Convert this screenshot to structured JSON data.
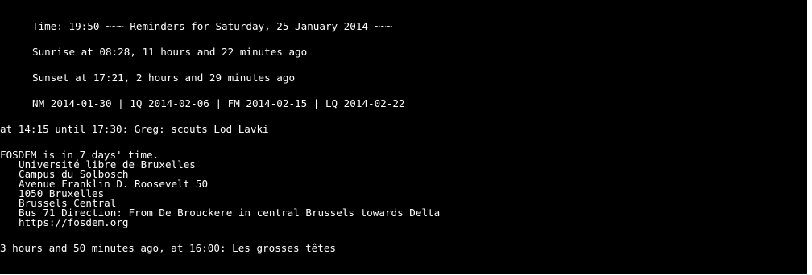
{
  "header": {
    "time_line": "Time: 19:50 ~~~ Reminders for Saturday, 25 January 2014 ~~~",
    "sunrise_line": "Sunrise at 08:28, 11 hours and 22 minutes ago",
    "sunset_line": "Sunset at 17:21, 2 hours and 29 minutes ago",
    "moon_line": "NM 2014-01-30 | 1Q 2014-02-06 | FM 2014-02-15 | LQ 2014-02-22"
  },
  "reminders": {
    "scouts_line": "at 14:15 until 17:30: Greg: scouts Lod Lavki",
    "fosdem_title": "FOSDEM is in 7 days' time.",
    "fosdem_details": [
      "Université libre de Bruxelles",
      "Campus du Solbosch",
      "Avenue Franklin D. Roosevelt 50",
      "1050 Bruxelles",
      "Brussels Central",
      "Bus 71 Direction: From De Brouckere in central Brussels towards Delta",
      "https://fosdem.org"
    ],
    "tetes_line": "3 hours and 50 minutes ago, at 16:00: Les grosses têtes"
  }
}
